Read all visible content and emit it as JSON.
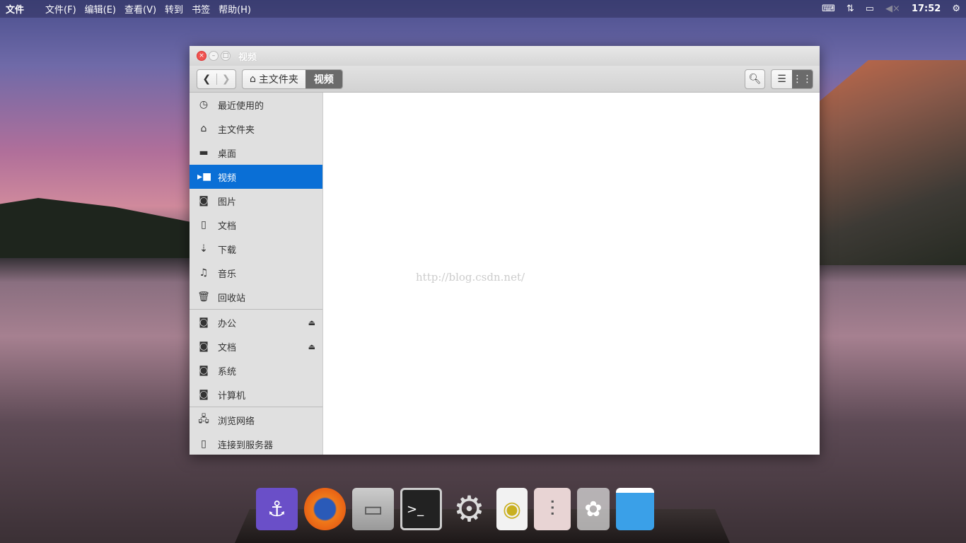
{
  "topbar": {
    "app": "文件",
    "menus": [
      "文件(F)",
      "编辑(E)",
      "查看(V)",
      "转到",
      "书签",
      "帮助(H)"
    ],
    "time": "17:52"
  },
  "window": {
    "title": "视频",
    "breadcrumb": [
      "主文件夹",
      "视频"
    ]
  },
  "sidebar": {
    "places": [
      {
        "label": "最近使用的",
        "icon": "clock-icon"
      },
      {
        "label": "主文件夹",
        "icon": "home-icon"
      },
      {
        "label": "桌面",
        "icon": "folder-icon"
      },
      {
        "label": "视频",
        "icon": "video-icon",
        "selected": true
      },
      {
        "label": "图片",
        "icon": "camera-icon"
      },
      {
        "label": "文档",
        "icon": "document-icon"
      },
      {
        "label": "下载",
        "icon": "download-icon"
      },
      {
        "label": "音乐",
        "icon": "music-icon"
      },
      {
        "label": "回收站",
        "icon": "trash-icon"
      }
    ],
    "devices": [
      {
        "label": "办公",
        "eject": true
      },
      {
        "label": "文档",
        "eject": true
      },
      {
        "label": "系统"
      },
      {
        "label": "计算机"
      }
    ],
    "network": [
      {
        "label": "浏览网络"
      },
      {
        "label": "连接到服务器"
      }
    ]
  },
  "watermark": "http://blog.csdn.net/",
  "dock": [
    "anchor",
    "firefox",
    "files",
    "terminal",
    "settings",
    "speaker",
    "mixer",
    "trash",
    "desktop"
  ]
}
